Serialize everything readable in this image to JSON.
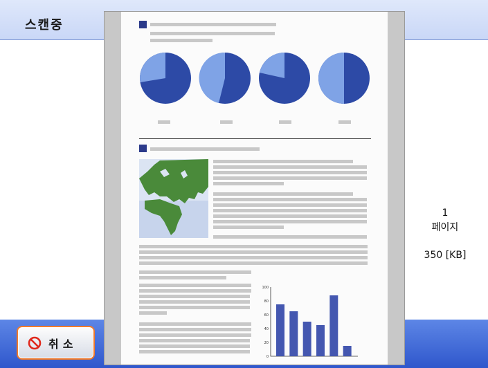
{
  "header": {
    "title": "스캔중"
  },
  "info": {
    "page_count": "1",
    "page_label": "페이지",
    "size": "350 [KB]"
  },
  "footer": {
    "cancel_label": "취소"
  },
  "icons": {
    "cancel": "prohibited-icon"
  },
  "colors": {
    "accent": "#f07a2b",
    "footer": "#3c64d4"
  },
  "chart_data": {
    "type": "bar",
    "categories": [
      "",
      "",
      "",
      "",
      "",
      ""
    ],
    "values": [
      75,
      65,
      50,
      45,
      88,
      15
    ],
    "ylim": [
      0,
      100
    ],
    "yticks": [
      "0",
      "20",
      "40",
      "60",
      "80",
      "100"
    ]
  }
}
